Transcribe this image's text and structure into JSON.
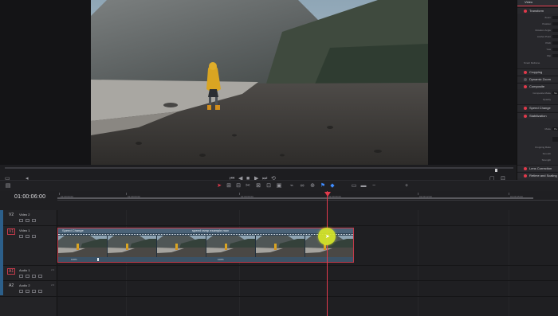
{
  "viewer": {
    "clip_title": "",
    "transport_icons": [
      "skip-start-icon",
      "step-back-icon",
      "stop-icon",
      "play-icon",
      "skip-end-icon",
      "loop-icon"
    ]
  },
  "inspector": {
    "tab": "Video",
    "sections": [
      {
        "label": "Transform",
        "on": true
      },
      {
        "label": "Cropping",
        "on": true
      },
      {
        "label": "Dynamic Zoom",
        "on": false
      },
      {
        "label": "Composite",
        "on": true
      },
      {
        "label": "Speed Change",
        "on": true
      },
      {
        "label": "Stabilization",
        "on": true
      },
      {
        "label": "Lens Correction",
        "on": true
      },
      {
        "label": "Retime and Scaling",
        "on": true
      }
    ],
    "transform_props": [
      "Zoom",
      "Position",
      "Rotation Angle",
      "Anchor Point",
      "Pitch",
      "Yaw",
      "Flip"
    ],
    "smart_reframe": "Smart Reframe",
    "composite_props": [
      "Composite Mode",
      "Opacity"
    ],
    "composite_mode_value": "No",
    "stab_props": [
      "Mode",
      "Cropping Ratio",
      "Smooth",
      "Strength"
    ],
    "stab_mode_value": "Pe"
  },
  "timeline": {
    "timecode": "01:00:06:00",
    "ruler_ticks": [
      "01:00:00:00",
      "01:00:03:00",
      "01:00:06:00",
      "01:00:09:00",
      "01:00:12:00",
      "01:00:15:00"
    ],
    "tracks": [
      {
        "id": "V2",
        "name": "Video 2",
        "kind": "video",
        "boxed": false,
        "num": ""
      },
      {
        "id": "V1",
        "name": "Video 1",
        "kind": "video",
        "boxed": true,
        "num": ""
      },
      {
        "id": "A1",
        "name": "Audio 1",
        "kind": "audio",
        "boxed": true,
        "num": "2.0"
      },
      {
        "id": "A2",
        "name": "Audio 2",
        "kind": "audio",
        "boxed": false,
        "num": "2.0"
      }
    ],
    "clip": {
      "name": "speed ramp example.mov",
      "speed_label": "Speed Change",
      "percent_left": "100%",
      "percent_mid": "100%",
      "border_color": "#c43a4a"
    },
    "playhead_color": "#e23b4c",
    "accent_blue": "#3f8cff"
  }
}
